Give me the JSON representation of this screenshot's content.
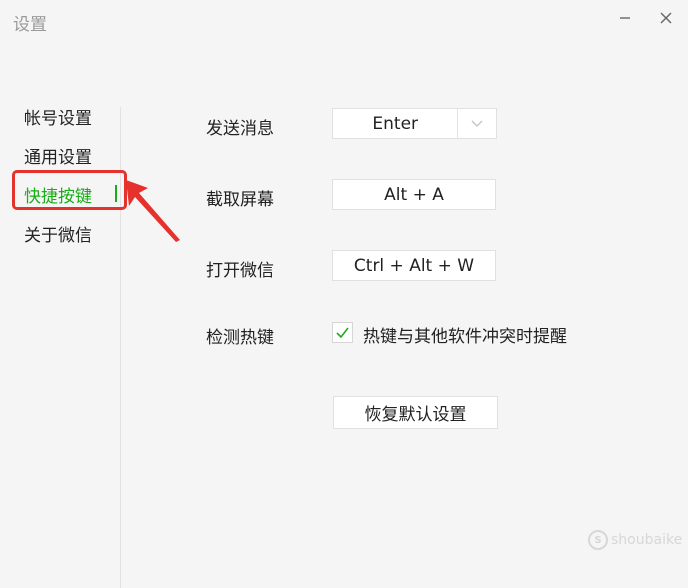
{
  "window": {
    "title": "设置"
  },
  "sidebar": {
    "items": [
      {
        "label": "帐号设置"
      },
      {
        "label": "通用设置"
      },
      {
        "label": "快捷按键",
        "active": true
      },
      {
        "label": "关于微信"
      }
    ]
  },
  "settings": {
    "send_message": {
      "label": "发送消息",
      "value": "Enter"
    },
    "screenshot": {
      "label": "截取屏幕",
      "value": "Alt + A"
    },
    "open_wechat": {
      "label": "打开微信",
      "value": "Ctrl + Alt + W"
    },
    "detect_hotkey": {
      "label": "检测热键",
      "checkbox_label": "热键与其他软件冲突时提醒",
      "checked": true
    },
    "reset_label": "恢复默认设置"
  },
  "watermark": {
    "text": "shoubaike"
  },
  "colors": {
    "accent": "#1aad19",
    "annotation": "#e5322d"
  }
}
